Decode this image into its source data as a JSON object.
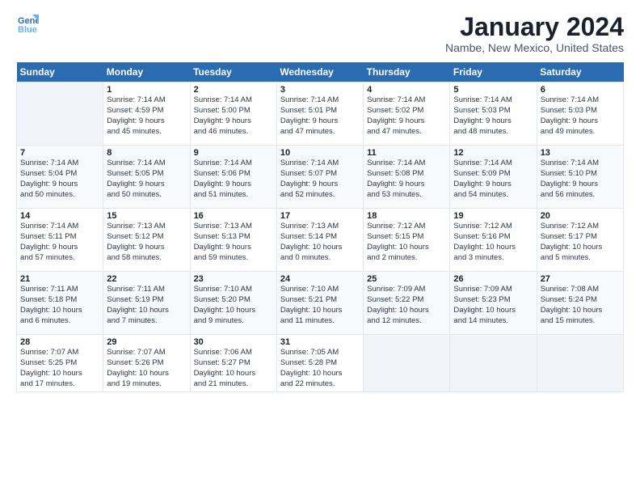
{
  "header": {
    "logo_line1": "General",
    "logo_line2": "Blue",
    "month": "January 2024",
    "location": "Nambe, New Mexico, United States"
  },
  "days_of_week": [
    "Sunday",
    "Monday",
    "Tuesday",
    "Wednesday",
    "Thursday",
    "Friday",
    "Saturday"
  ],
  "weeks": [
    [
      {
        "day": "",
        "info": ""
      },
      {
        "day": "1",
        "info": "Sunrise: 7:14 AM\nSunset: 4:59 PM\nDaylight: 9 hours\nand 45 minutes."
      },
      {
        "day": "2",
        "info": "Sunrise: 7:14 AM\nSunset: 5:00 PM\nDaylight: 9 hours\nand 46 minutes."
      },
      {
        "day": "3",
        "info": "Sunrise: 7:14 AM\nSunset: 5:01 PM\nDaylight: 9 hours\nand 47 minutes."
      },
      {
        "day": "4",
        "info": "Sunrise: 7:14 AM\nSunset: 5:02 PM\nDaylight: 9 hours\nand 47 minutes."
      },
      {
        "day": "5",
        "info": "Sunrise: 7:14 AM\nSunset: 5:03 PM\nDaylight: 9 hours\nand 48 minutes."
      },
      {
        "day": "6",
        "info": "Sunrise: 7:14 AM\nSunset: 5:03 PM\nDaylight: 9 hours\nand 49 minutes."
      }
    ],
    [
      {
        "day": "7",
        "info": "Sunrise: 7:14 AM\nSunset: 5:04 PM\nDaylight: 9 hours\nand 50 minutes."
      },
      {
        "day": "8",
        "info": "Sunrise: 7:14 AM\nSunset: 5:05 PM\nDaylight: 9 hours\nand 50 minutes."
      },
      {
        "day": "9",
        "info": "Sunrise: 7:14 AM\nSunset: 5:06 PM\nDaylight: 9 hours\nand 51 minutes."
      },
      {
        "day": "10",
        "info": "Sunrise: 7:14 AM\nSunset: 5:07 PM\nDaylight: 9 hours\nand 52 minutes."
      },
      {
        "day": "11",
        "info": "Sunrise: 7:14 AM\nSunset: 5:08 PM\nDaylight: 9 hours\nand 53 minutes."
      },
      {
        "day": "12",
        "info": "Sunrise: 7:14 AM\nSunset: 5:09 PM\nDaylight: 9 hours\nand 54 minutes."
      },
      {
        "day": "13",
        "info": "Sunrise: 7:14 AM\nSunset: 5:10 PM\nDaylight: 9 hours\nand 56 minutes."
      }
    ],
    [
      {
        "day": "14",
        "info": "Sunrise: 7:14 AM\nSunset: 5:11 PM\nDaylight: 9 hours\nand 57 minutes."
      },
      {
        "day": "15",
        "info": "Sunrise: 7:13 AM\nSunset: 5:12 PM\nDaylight: 9 hours\nand 58 minutes."
      },
      {
        "day": "16",
        "info": "Sunrise: 7:13 AM\nSunset: 5:13 PM\nDaylight: 9 hours\nand 59 minutes."
      },
      {
        "day": "17",
        "info": "Sunrise: 7:13 AM\nSunset: 5:14 PM\nDaylight: 10 hours\nand 0 minutes."
      },
      {
        "day": "18",
        "info": "Sunrise: 7:12 AM\nSunset: 5:15 PM\nDaylight: 10 hours\nand 2 minutes."
      },
      {
        "day": "19",
        "info": "Sunrise: 7:12 AM\nSunset: 5:16 PM\nDaylight: 10 hours\nand 3 minutes."
      },
      {
        "day": "20",
        "info": "Sunrise: 7:12 AM\nSunset: 5:17 PM\nDaylight: 10 hours\nand 5 minutes."
      }
    ],
    [
      {
        "day": "21",
        "info": "Sunrise: 7:11 AM\nSunset: 5:18 PM\nDaylight: 10 hours\nand 6 minutes."
      },
      {
        "day": "22",
        "info": "Sunrise: 7:11 AM\nSunset: 5:19 PM\nDaylight: 10 hours\nand 7 minutes."
      },
      {
        "day": "23",
        "info": "Sunrise: 7:10 AM\nSunset: 5:20 PM\nDaylight: 10 hours\nand 9 minutes."
      },
      {
        "day": "24",
        "info": "Sunrise: 7:10 AM\nSunset: 5:21 PM\nDaylight: 10 hours\nand 11 minutes."
      },
      {
        "day": "25",
        "info": "Sunrise: 7:09 AM\nSunset: 5:22 PM\nDaylight: 10 hours\nand 12 minutes."
      },
      {
        "day": "26",
        "info": "Sunrise: 7:09 AM\nSunset: 5:23 PM\nDaylight: 10 hours\nand 14 minutes."
      },
      {
        "day": "27",
        "info": "Sunrise: 7:08 AM\nSunset: 5:24 PM\nDaylight: 10 hours\nand 15 minutes."
      }
    ],
    [
      {
        "day": "28",
        "info": "Sunrise: 7:07 AM\nSunset: 5:25 PM\nDaylight: 10 hours\nand 17 minutes."
      },
      {
        "day": "29",
        "info": "Sunrise: 7:07 AM\nSunset: 5:26 PM\nDaylight: 10 hours\nand 19 minutes."
      },
      {
        "day": "30",
        "info": "Sunrise: 7:06 AM\nSunset: 5:27 PM\nDaylight: 10 hours\nand 21 minutes."
      },
      {
        "day": "31",
        "info": "Sunrise: 7:05 AM\nSunset: 5:28 PM\nDaylight: 10 hours\nand 22 minutes."
      },
      {
        "day": "",
        "info": ""
      },
      {
        "day": "",
        "info": ""
      },
      {
        "day": "",
        "info": ""
      }
    ]
  ]
}
